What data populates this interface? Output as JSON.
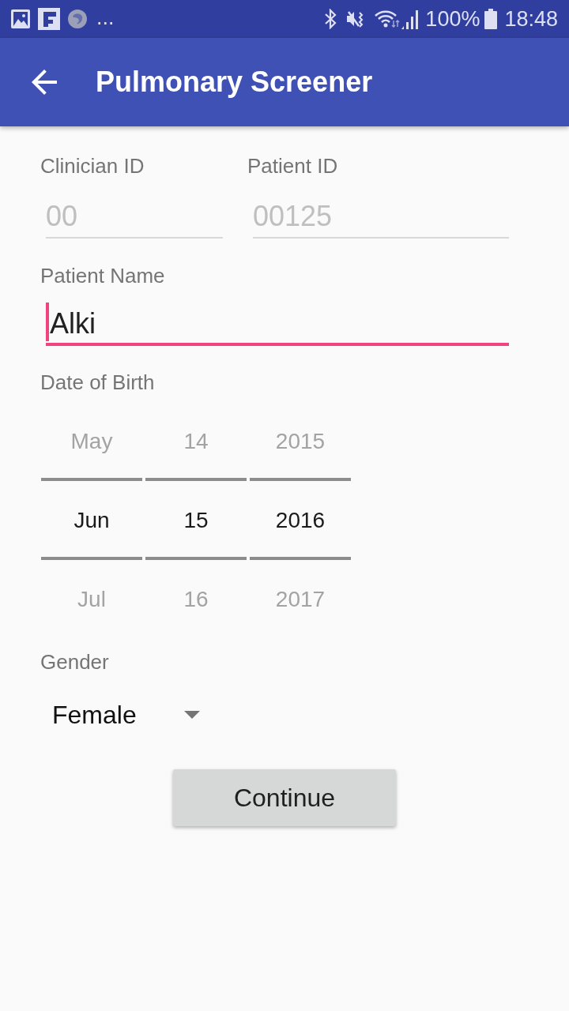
{
  "status_bar": {
    "more_notifications": "...",
    "battery": "100%",
    "time": "18:48"
  },
  "app_bar": {
    "title": "Pulmonary Screener"
  },
  "id_fields": [
    {
      "label": "Clinician ID",
      "value": "00",
      "disabled": true,
      "focused": false
    },
    {
      "label": "Patient ID",
      "value": "00125",
      "disabled": true,
      "focused": false
    }
  ],
  "name_field": {
    "label": "Patient Name",
    "value": "Alki",
    "disabled": false,
    "focused": true
  },
  "date_of_birth": {
    "label": "Date of Birth",
    "columns": [
      {
        "items": [
          {
            "text": "May",
            "selected": false
          },
          {
            "text": "Jun",
            "selected": true
          },
          {
            "text": "Jul",
            "selected": false
          }
        ]
      },
      {
        "items": [
          {
            "text": "14",
            "selected": false
          },
          {
            "text": "15",
            "selected": true
          },
          {
            "text": "16",
            "selected": false
          }
        ]
      },
      {
        "items": [
          {
            "text": "2015",
            "selected": false
          },
          {
            "text": "2016",
            "selected": true
          },
          {
            "text": "2017",
            "selected": false
          }
        ]
      }
    ]
  },
  "gender": {
    "label": "Gender",
    "value": "Female"
  },
  "continue_button": {
    "label": "Continue"
  }
}
